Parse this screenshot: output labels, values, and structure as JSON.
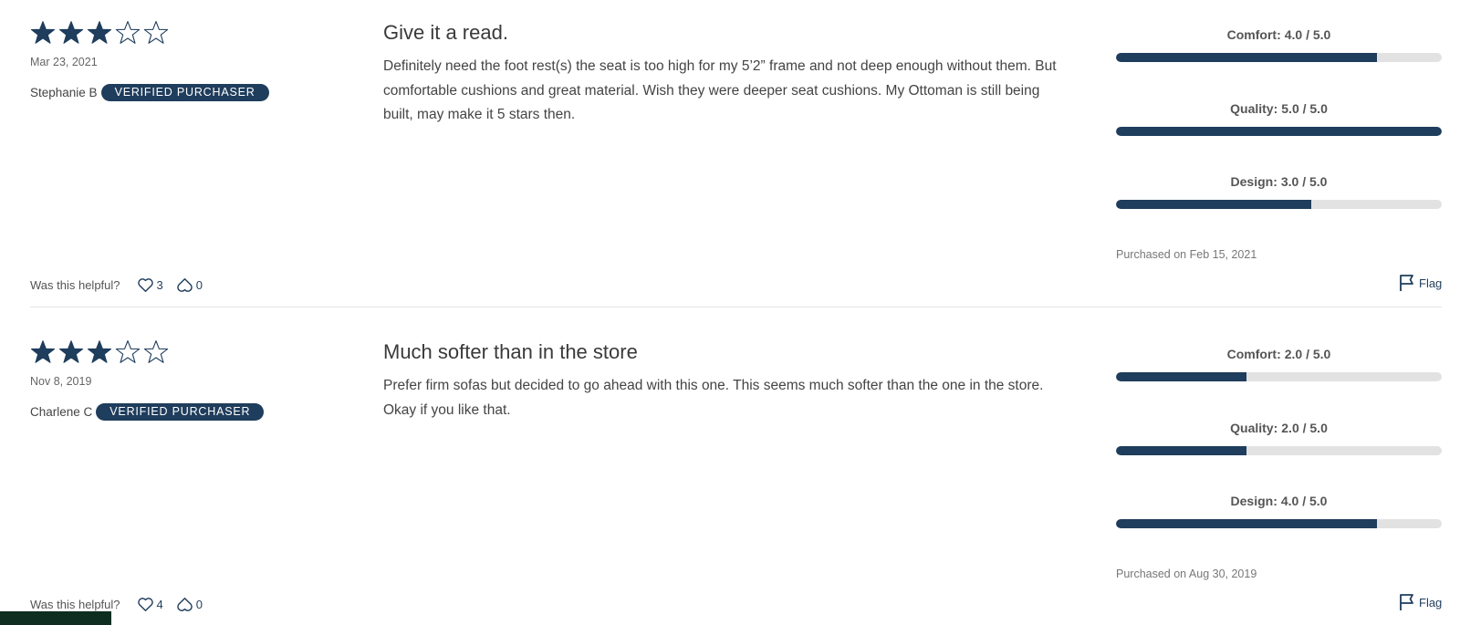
{
  "colors": {
    "accent": "#1f3d5c",
    "track": "#e2e2e2",
    "corner": "#0d2e21"
  },
  "reviews": [
    {
      "stars": 3,
      "max_stars": 5,
      "date": "Mar 23, 2021",
      "reviewer": "Stephanie B",
      "badge": "VERIFIED PURCHASER",
      "title": "Give it a read.",
      "body": "Definitely need the foot rest(s) the seat is too high for my 5’2” frame and not deep enough without them. But comfortable cushions and great material. Wish they were deeper seat cushions. My Ottoman is still being built, may make it 5 stars then.",
      "ratings": [
        {
          "label": "Comfort:",
          "value": "4.0 / 5.0",
          "score": 4.0,
          "max": 5.0
        },
        {
          "label": "Quality:",
          "value": "5.0 / 5.0",
          "score": 5.0,
          "max": 5.0
        },
        {
          "label": "Design:",
          "value": "3.0 / 5.0",
          "score": 3.0,
          "max": 5.0
        }
      ],
      "purchased": "Purchased on Feb 15, 2021",
      "helpful_label": "Was this helpful?",
      "likes": "3",
      "dislikes": "0",
      "flag_label": "Flag"
    },
    {
      "stars": 3,
      "max_stars": 5,
      "date": "Nov 8, 2019",
      "reviewer": "Charlene C",
      "badge": "VERIFIED PURCHASER",
      "title": "Much softer than in the store",
      "body": "Prefer firm sofas but decided to go ahead with this one. This seems much softer than the one in the store. Okay if you like that.",
      "ratings": [
        {
          "label": "Comfort:",
          "value": "2.0 / 5.0",
          "score": 2.0,
          "max": 5.0
        },
        {
          "label": "Quality:",
          "value": "2.0 / 5.0",
          "score": 2.0,
          "max": 5.0
        },
        {
          "label": "Design:",
          "value": "4.0 / 5.0",
          "score": 4.0,
          "max": 5.0
        }
      ],
      "purchased": "Purchased on Aug 30, 2019",
      "helpful_label": "Was this helpful?",
      "likes": "4",
      "dislikes": "0",
      "flag_label": "Flag"
    }
  ]
}
